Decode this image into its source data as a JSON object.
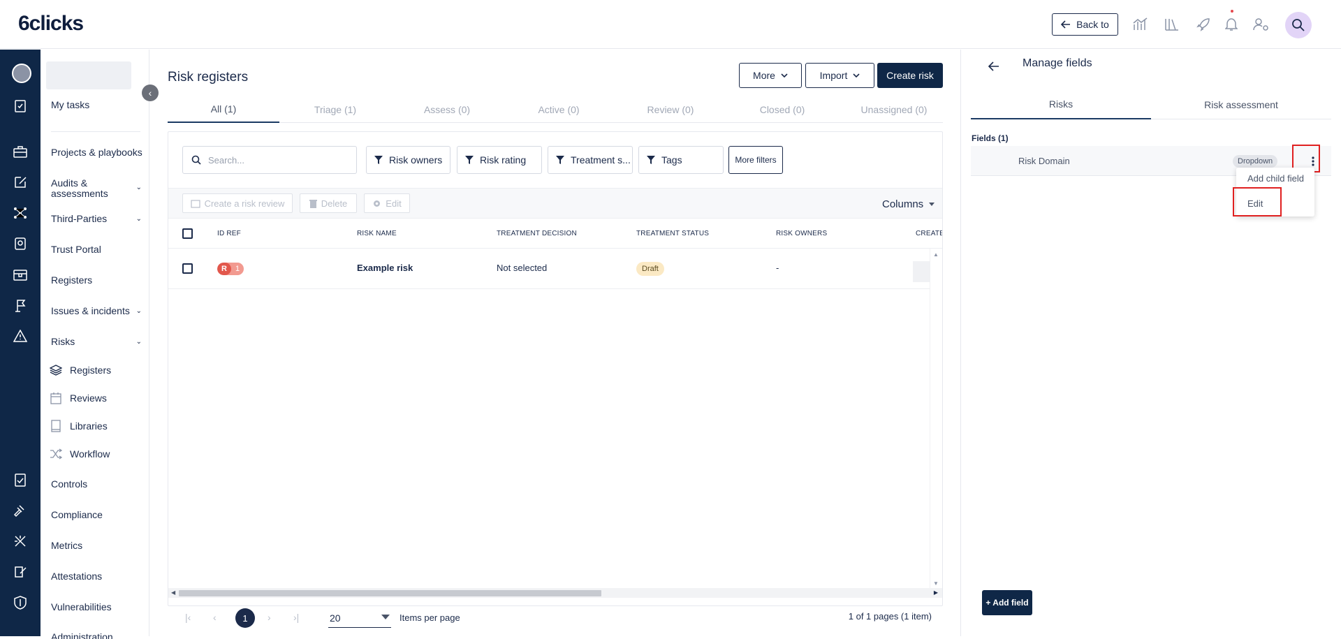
{
  "app": {
    "logo": "6clicks",
    "back_to_label": "Back to"
  },
  "sidenav": {
    "my_tasks": "My tasks",
    "items": [
      {
        "label": "Projects & playbooks"
      },
      {
        "label": "Audits & assessments"
      },
      {
        "label": "Third-Parties"
      },
      {
        "label": "Trust Portal"
      },
      {
        "label": "Registers"
      },
      {
        "label": "Issues & incidents"
      },
      {
        "label": "Risks"
      },
      {
        "label": "Controls"
      },
      {
        "label": "Compliance"
      },
      {
        "label": "Metrics"
      },
      {
        "label": "Attestations"
      },
      {
        "label": "Vulnerabilities"
      },
      {
        "label": "Administration"
      }
    ],
    "risks_sub": [
      {
        "label": "Registers",
        "icon": "layers-icon"
      },
      {
        "label": "Reviews",
        "icon": "calendar-icon"
      },
      {
        "label": "Libraries",
        "icon": "book-icon"
      },
      {
        "label": "Workflow",
        "icon": "shuffle-icon"
      }
    ]
  },
  "main": {
    "title": "Risk registers",
    "more_label": "More",
    "import_label": "Import",
    "create_label": "Create risk",
    "tabs": [
      {
        "label": "All (1)",
        "active": true
      },
      {
        "label": "Triage (1)"
      },
      {
        "label": "Assess (0)"
      },
      {
        "label": "Active (0)"
      },
      {
        "label": "Review (0)"
      },
      {
        "label": "Closed (0)"
      },
      {
        "label": "Unassigned (0)"
      }
    ],
    "search_placeholder": "Search...",
    "filters": [
      "Risk owners",
      "Risk rating",
      "Treatment s...",
      "Tags"
    ],
    "more_filters_label": "More filters",
    "actions": {
      "create_review": "Create a risk review",
      "delete": "Delete",
      "edit": "Edit",
      "columns": "Columns"
    },
    "columns": [
      "ID REF",
      "RISK NAME",
      "TREATMENT DECISION",
      "TREATMENT STATUS",
      "RISK OWNERS",
      "CREATED"
    ],
    "rows": [
      {
        "id_prefix": "R",
        "id_num": "1",
        "name": "Example risk",
        "decision": "Not selected",
        "status": "Draft",
        "owners": "-"
      }
    ],
    "pagination": {
      "current_page": "1",
      "per_page": "20",
      "per_page_label": "Items per page",
      "info": "1 of 1 pages (1 item)"
    }
  },
  "panel": {
    "title": "Manage fields",
    "tabs": [
      {
        "label": "Risks",
        "active": true
      },
      {
        "label": "Risk assessment"
      }
    ],
    "fields_label": "Fields (1)",
    "fields": [
      {
        "name": "Risk Domain",
        "type": "Dropdown"
      }
    ],
    "menu": {
      "add_child": "Add child field",
      "edit": "Edit"
    },
    "add_field_label": "+ Add field"
  },
  "colors": {
    "navy": "#0f2747",
    "highlight": "#e02020",
    "risk_badge": "#e2574c",
    "draft_badge": "#fbe9c4"
  }
}
